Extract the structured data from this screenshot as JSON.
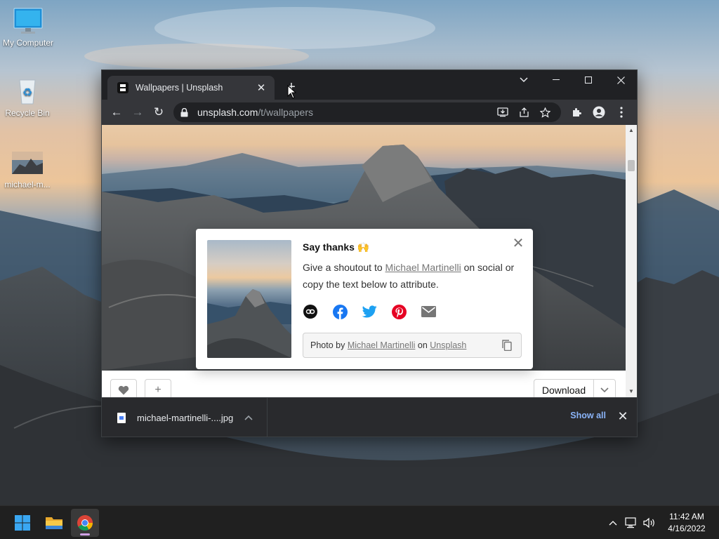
{
  "desktop": {
    "icons": [
      {
        "label": "My Computer",
        "icon": "monitor-icon"
      },
      {
        "label": "Recycle Bin",
        "icon": "recycle-bin-icon"
      },
      {
        "label": "michael-m...",
        "icon": "image-file-icon"
      }
    ]
  },
  "browser": {
    "tab": {
      "title": "Wallpapers | Unsplash",
      "close": "✕"
    },
    "new_tab": "+",
    "window_controls": {
      "dropdown": "⌄",
      "minimize": "—",
      "maximize": "☐",
      "close": "✕"
    },
    "nav": {
      "back": "←",
      "forward": "→",
      "reload": "↻"
    },
    "address": {
      "host": "unsplash.com",
      "path": "/t/wallpapers"
    },
    "toolbar_icons": [
      "install-icon",
      "share-icon",
      "bookmark-star-icon",
      "extensions-icon",
      "profile-icon",
      "menu-icon"
    ],
    "page": {
      "like_icon": "heart-icon",
      "add_label": "+",
      "download_label": "Download",
      "download_chevron": "⌄"
    },
    "modal": {
      "heading": "Say thanks 🙌",
      "text_before": "Give a shoutout to ",
      "author": "Michael Martinelli",
      "text_after": " on social or copy the text below to attribute.",
      "share_icons": [
        "link-icon",
        "facebook-icon",
        "twitter-icon",
        "pinterest-icon",
        "email-icon"
      ],
      "attribution": {
        "prefix": "Photo by ",
        "author": "Michael Martinelli",
        "middle": " on ",
        "site": "Unsplash"
      },
      "close": "✕"
    },
    "download_shelf": {
      "file_name": "michael-martinelli-....jpg",
      "show_all": "Show all",
      "close": "✕"
    }
  },
  "taskbar": {
    "apps": [
      "start-icon",
      "file-explorer-icon",
      "chrome-icon"
    ],
    "tray": {
      "time": "11:42 AM",
      "date": "4/16/2022"
    }
  },
  "colors": {
    "browser_dark": "#202124",
    "toolbar": "#35363a",
    "link_blue": "#8ab4f8",
    "taskbar": "#202020",
    "facebook": "#1877f2",
    "twitter": "#1da1f2",
    "pinterest": "#e60023"
  }
}
